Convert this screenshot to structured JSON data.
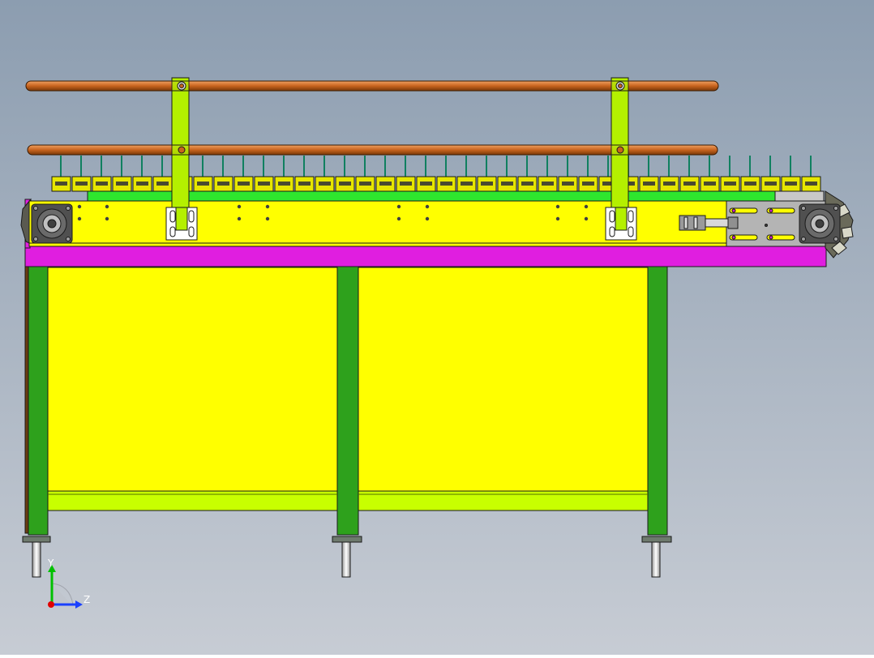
{
  "viewport": {
    "background_top": "#8c9db0",
    "background_bottom": "#c7ccd4"
  },
  "colors": {
    "frame_yellow": "#ffff00",
    "frame_green": "#2ea11c",
    "rail_lime": "#c8ff00",
    "side_magenta": "#e01ee0",
    "handrail_copper": "#c8641e",
    "bracket_lime": "#b4f000",
    "tensioner_grey": "#b4b4b4",
    "pin_green": "#108060",
    "slat_yellow": "#e6e600",
    "outline": "#1a1a1a"
  },
  "axis_triad": {
    "x_label": "",
    "y_label": "Y",
    "z_label": "Z",
    "y_color": "#00c000",
    "z_color": "#1a40ff",
    "origin_color": "#e00000"
  }
}
